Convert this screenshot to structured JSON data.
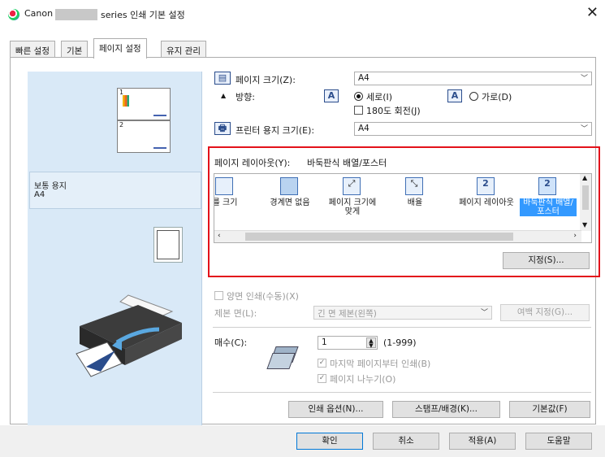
{
  "window": {
    "title_brand": "Canon",
    "title_rest": "series 인쇄 기본 설정",
    "close": "✕"
  },
  "tabs": [
    {
      "label": "빠른 설정",
      "active": false
    },
    {
      "label": "기본",
      "active": false
    },
    {
      "label": "페이지 설정",
      "active": true
    },
    {
      "label": "유지 관리",
      "active": false
    }
  ],
  "preview": {
    "page1": "1",
    "page2": "2",
    "paper_type": "보통 용지",
    "paper_size": "A4"
  },
  "page_size": {
    "label": "페이지 크기(Z):",
    "value": "A4"
  },
  "orientation": {
    "label": "방향:",
    "icon_letter": "A",
    "portrait": "세로(I)",
    "landscape": "가로(D)",
    "rotate180": "180도 회전(J)"
  },
  "printer_paper": {
    "label": "프린터 용지 크기(E):",
    "value": "A4"
  },
  "page_layout": {
    "label": "페이지 레이아웃(Y):",
    "current": "바둑판식 배열/포스터",
    "items": [
      {
        "label": "를 크기",
        "glyph": ""
      },
      {
        "label": "경계면 없음",
        "glyph": ""
      },
      {
        "label": "페이지 크기에 맞게",
        "glyph": "⤢"
      },
      {
        "label": "배율",
        "glyph": "⤡"
      },
      {
        "label": "페이지 레이아웃",
        "glyph": "2"
      },
      {
        "label": "바둑판식 배열/포스터",
        "glyph": "2"
      }
    ],
    "specify_button": "지정(S)..."
  },
  "duplex": {
    "label": "양면 인쇄(수동)(X)",
    "stapling_label": "제본 면(L):",
    "stapling_value": "긴 면 제본(왼쪽)",
    "margin_button": "여백 지정(G)..."
  },
  "copies": {
    "label": "매수(C):",
    "value": "1",
    "range": "(1-999)",
    "last_first": "마지막 페이지부터 인쇄(B)",
    "collate": "페이지 나누기(O)"
  },
  "action_buttons": {
    "print_options": "인쇄 옵션(N)...",
    "stamp": "스탬프/배경(K)...",
    "defaults": "기본값(F)"
  },
  "dialog_buttons": {
    "ok": "확인",
    "cancel": "취소",
    "apply": "적용(A)",
    "help": "도움말"
  }
}
